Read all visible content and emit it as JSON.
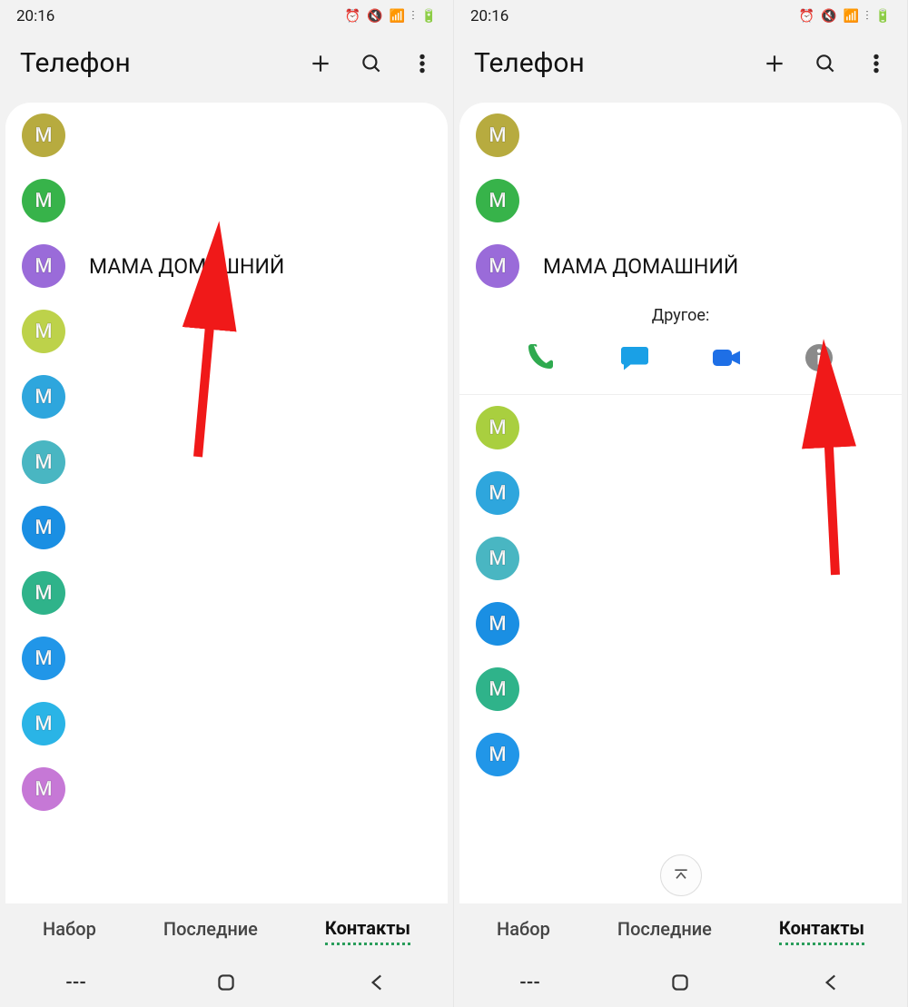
{
  "status": {
    "time": "20:16"
  },
  "header": {
    "title": "Телефон"
  },
  "contacts_left": [
    {
      "letter": "M",
      "color": "#b7ab3f",
      "name": ""
    },
    {
      "letter": "M",
      "color": "#37b34a",
      "name": ""
    },
    {
      "letter": "M",
      "color": "#9a6bd9",
      "name": "МАМА ДОМАШНИЙ"
    },
    {
      "letter": "M",
      "color": "#bdd24a",
      "name": ""
    },
    {
      "letter": "M",
      "color": "#2ea6dd",
      "name": ""
    },
    {
      "letter": "M",
      "color": "#49b6c2",
      "name": ""
    },
    {
      "letter": "M",
      "color": "#1a8fe3",
      "name": ""
    },
    {
      "letter": "M",
      "color": "#2fb38a",
      "name": ""
    },
    {
      "letter": "M",
      "color": "#2196e8",
      "name": ""
    },
    {
      "letter": "M",
      "color": "#2ab4e6",
      "name": ""
    },
    {
      "letter": "M",
      "color": "#c678d6",
      "name": ""
    }
  ],
  "contacts_right": [
    {
      "letter": "M",
      "color": "#b7ab3f",
      "name": ""
    },
    {
      "letter": "M",
      "color": "#37b34a",
      "name": ""
    },
    {
      "letter": "M",
      "color": "#9a6bd9",
      "name": "МАМА ДОМАШНИЙ"
    }
  ],
  "expand": {
    "label": "Другое:"
  },
  "contacts_right_after": [
    {
      "letter": "M",
      "color": "#a9cf3f",
      "name": ""
    },
    {
      "letter": "M",
      "color": "#2ea6dd",
      "name": ""
    },
    {
      "letter": "M",
      "color": "#49b6c2",
      "name": ""
    },
    {
      "letter": "M",
      "color": "#1a8fe3",
      "name": ""
    },
    {
      "letter": "M",
      "color": "#2fb38a",
      "name": ""
    },
    {
      "letter": "M",
      "color": "#2196e8",
      "name": ""
    }
  ],
  "tabs": {
    "dial": "Набор",
    "recent": "Последние",
    "contacts": "Контакты"
  }
}
